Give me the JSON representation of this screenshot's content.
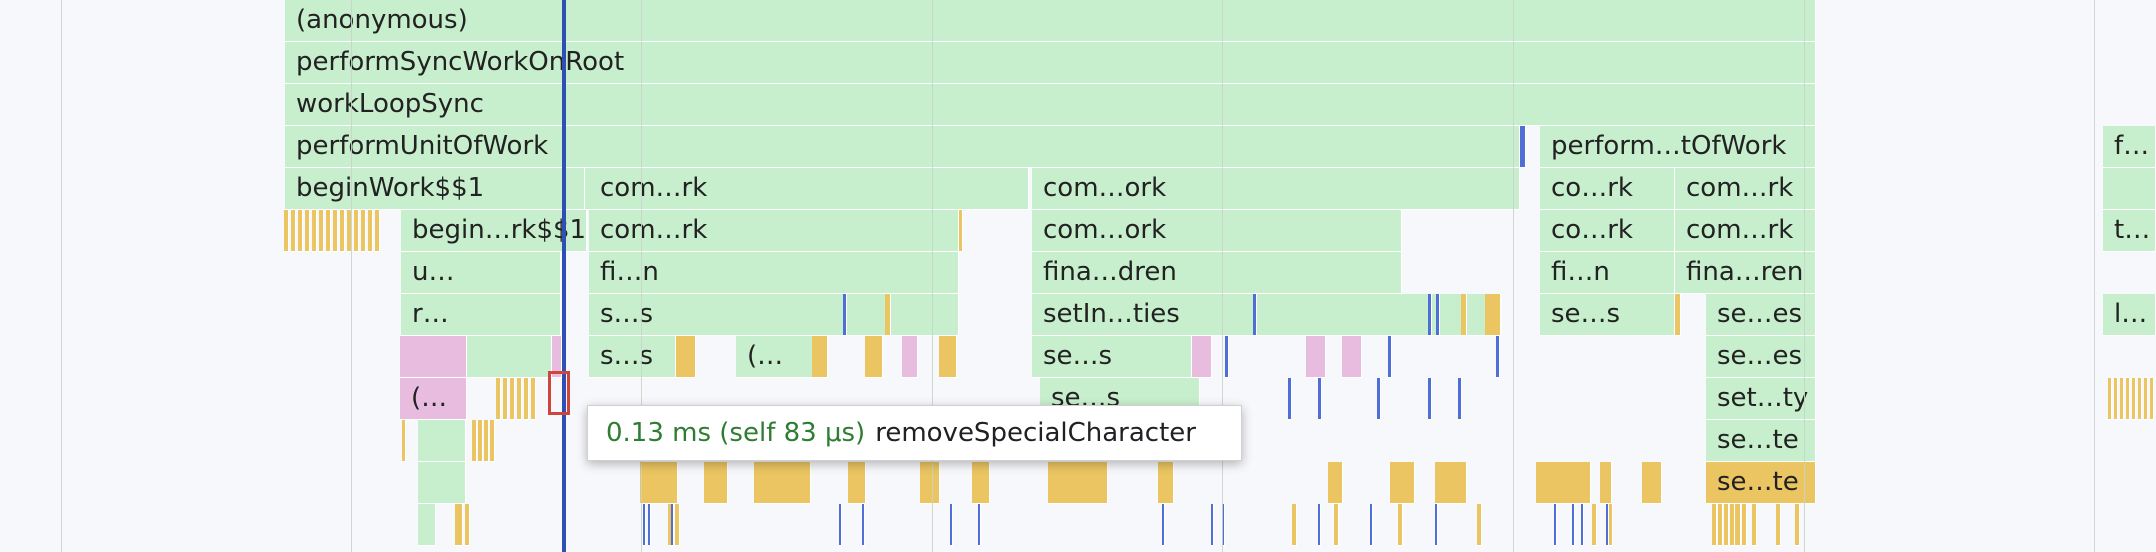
{
  "colors": {
    "scripting": "#c8efcd",
    "scripting_dark": "#b6e2bc",
    "yellow": "#ebc561",
    "pink": "#e8bcdf",
    "blue_mark": "#4f6fd6",
    "background": "#f7f8fc"
  },
  "tooltip": {
    "time": "0.13 ms (self 83 μs)",
    "name": "removeSpecialCharacter"
  },
  "labels": {
    "anonymous": "(anonymous)",
    "perform_sync_work_on_root": "performSyncWorkOnRoot",
    "work_loop_sync": "workLoopSync",
    "perform_unit_of_work": "performUnitOfWork",
    "perform_unit_of_work_2": "perform…tOfWork",
    "f_trunc": "f…",
    "begin_work": "beginWork$$1",
    "complete_rk_a": "com…rk",
    "complete_ork_b": "com…ork",
    "co_rk_c": "co…rk",
    "complete_rk_d": "com…rk",
    "begin_rk": "begin…rk$$1",
    "complete_rk_e": "com…rk",
    "complete_ork_f": "com…ork",
    "co_rk_g": "co…rk",
    "complete_rk_h": "com…rk",
    "t_trunc": "t…",
    "u_trunc": "u…",
    "fi_n_a": "fi…n",
    "fina_dren": "fina…dren",
    "fi_n_b": "fi…n",
    "fina_ren": "fina…ren",
    "r_trunc": "r…",
    "s_s_a": "s…s",
    "setin_ties": "setIn…ties",
    "se_s_b": "se…s",
    "se_es_a": "se…es",
    "l_trunc": "l…",
    "s_s_c": "s…s",
    "paren_a": "(…",
    "se_s_c": "se…s",
    "se_es_b": "se…es",
    "paren_b": "(…",
    "se_s_d": "se…s",
    "set_ty": "set…ty",
    "se_te_a": "se…te",
    "se_te_b": "se…te"
  }
}
